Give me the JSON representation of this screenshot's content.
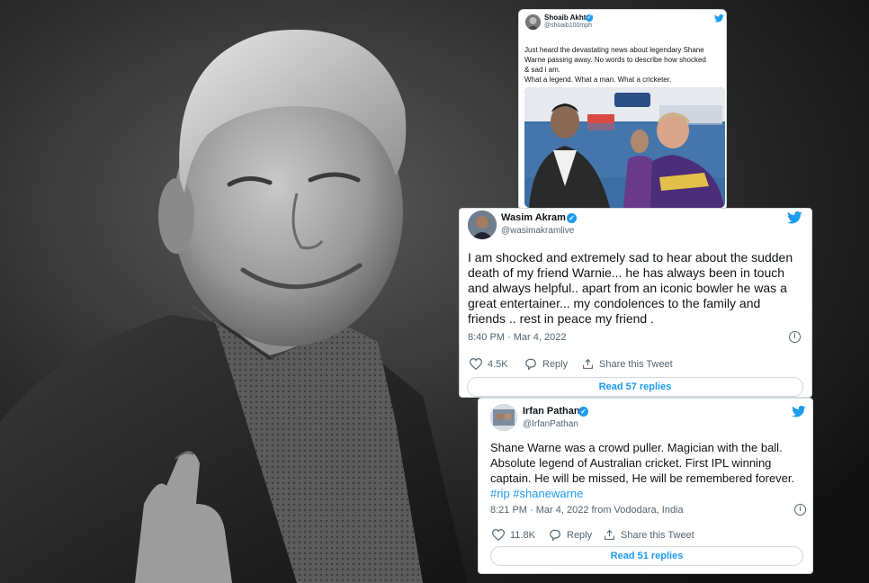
{
  "colors": {
    "twitter_blue": "#1d9bf0",
    "text_primary": "#0f1419",
    "text_secondary": "#536471",
    "background_photo": "grayscale"
  },
  "background": {
    "icon": "man-thumbs-up-grayscale-photo"
  },
  "tweets": [
    {
      "author": "Shoaib Akhtar",
      "handle": "@shoaib100mph",
      "verified": true,
      "lines": [
        "Just heard the devastating news about legendary Shane",
        "Warne passing away. No words to describe how shocked",
        "& sad i am.",
        "What a legend. What a man. What a cricketer."
      ],
      "media": "photo-two-cricketers-embracing"
    },
    {
      "author": "Wasim Akram",
      "handle": "@wasimakramlive",
      "verified": true,
      "lines": [
        "I am shocked and extremely sad to hear about the sudden",
        "death of my friend Warnie... he has always been in touch",
        "and always helpful.. apart from an iconic bowler he was a",
        "great entertainer... my condolences to the family and",
        "friends .. rest in peace my friend ."
      ],
      "timestamp": "8:40 PM · Mar 4, 2022",
      "likes": "4.5K",
      "reply_label": "Reply",
      "share_label": "Share this Tweet",
      "replies_button": "Read 57 replies"
    },
    {
      "author": "Irfan Pathan",
      "handle": "@IrfanPathan",
      "verified": true,
      "lines": [
        "Shane Warne was a crowd puller. Magician with the ball.",
        "Absolute legend of Australian cricket. First IPL winning",
        "captain. He will be missed, He will be remembered forever."
      ],
      "hashtags": "#rip #shanewarne",
      "timestamp": "8:21 PM · Mar 4, 2022 from Vododara, India",
      "likes": "11.8K",
      "reply_label": "Reply",
      "share_label": "Share this Tweet",
      "replies_button": "Read 51 replies"
    }
  ]
}
